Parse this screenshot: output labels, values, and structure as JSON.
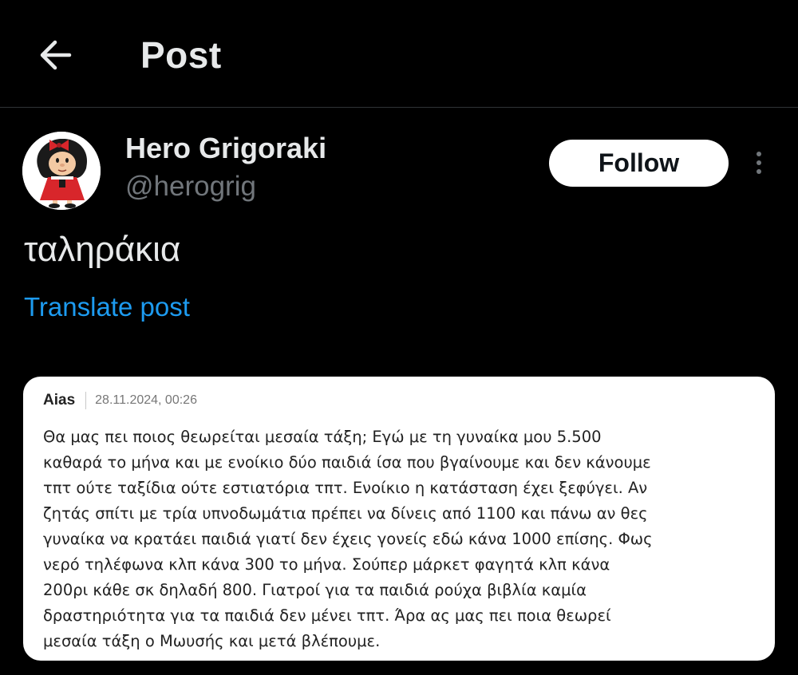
{
  "header": {
    "back_icon": "arrow-left-icon",
    "title": "Post"
  },
  "author": {
    "display_name": "Hero Grigoraki",
    "handle": "@herogrig",
    "avatar_icon": "mafalda-avatar"
  },
  "actions": {
    "follow_label": "Follow",
    "more_icon": "more-vertical-icon"
  },
  "post": {
    "text": "ταληράκια",
    "translate_label": "Translate post"
  },
  "quoted_card": {
    "author": "Aias",
    "date": "28.11.2024, 00:26",
    "lines": [
      "Θα μας πει ποιος θεωρείται μεσαία τάξη; Εγώ με τη γυναίκα μου 5.500",
      "καθαρά το μήνα και με ενοίκιο δύο παιδιά ίσα που βγαίνουμε και δεν κάνουμε",
      "τπτ ούτε ταξίδια ούτε εστιατόρια τπτ. Ενοίκιο η κατάσταση έχει ξεφύγει. Αν",
      "ζητάς σπίτι με τρία υπνοδωμάτια πρέπει να δίνεις από 1100 και πάνω αν θες",
      "γυναίκα να κρατάει παιδιά γιατί δεν έχεις γονείς εδώ κάνα 1000 επίσης. Φως",
      "νερό τηλέφωνα κλπ κάνα 300 το μήνα. Σούπερ μάρκετ φαγητά κλπ κάνα",
      "200ρι κάθε σκ δηλαδή 800. Γιατροί για τα παιδιά ρούχα βιβλία καμία",
      "δραστηριότητα για τα παιδιά δεν μένει τπτ. Άρα ας μας πει ποια θεωρεί",
      "μεσαία τάξη ο Μωυσής και μετά βλέπουμε."
    ]
  },
  "colors": {
    "background": "#000000",
    "primary_text": "#e7e9ea",
    "secondary_text": "#71767b",
    "link": "#1d9bf0",
    "follow_bg": "#ffffff",
    "card_bg": "#ffffff"
  }
}
